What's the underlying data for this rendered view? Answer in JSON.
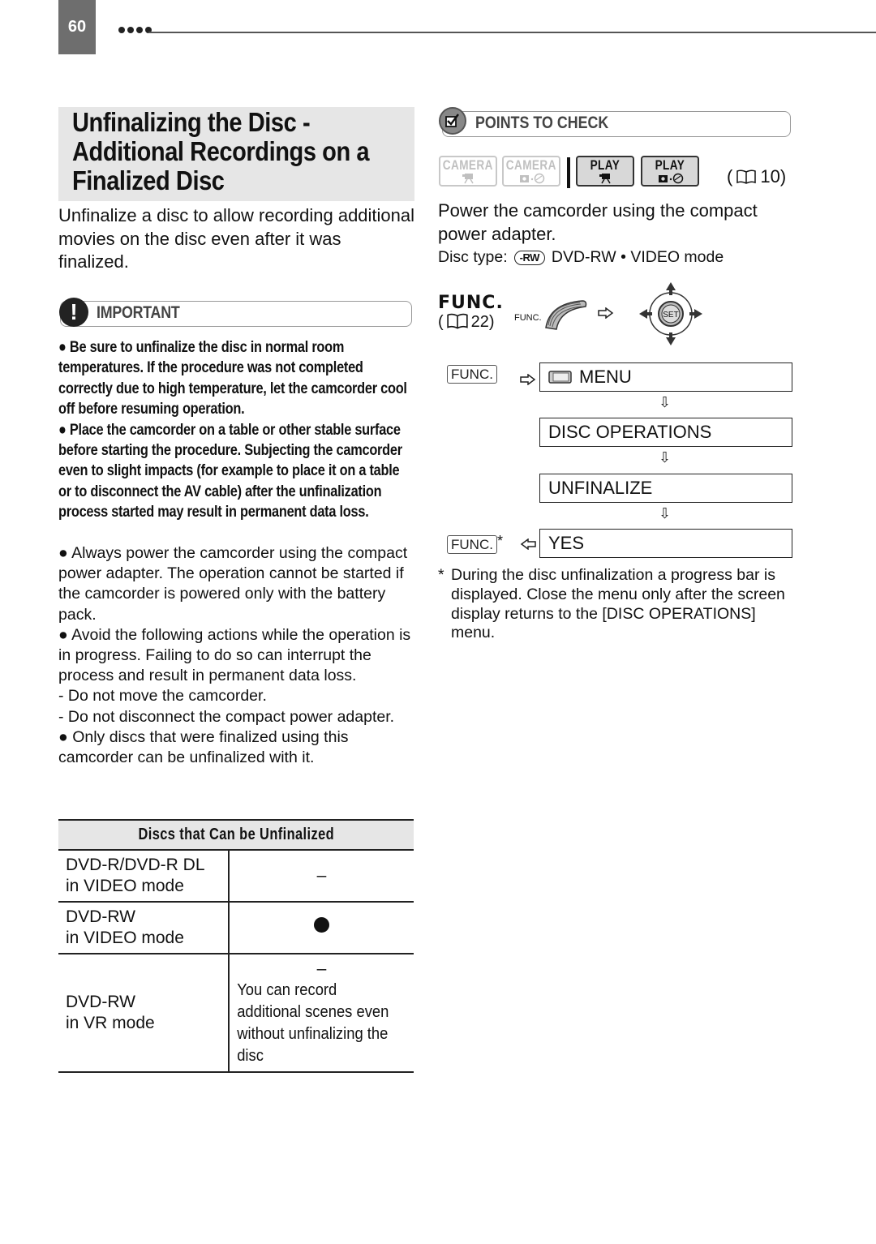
{
  "header": {
    "page_number": "60"
  },
  "title": {
    "lines": [
      "Unfinalizing the Disc -",
      "Additional Recordings on a",
      "Finalized Disc"
    ]
  },
  "intro": "Unfinalize a disc to allow recording additional movies on the disc even after it was finalized.",
  "important": {
    "label": "IMPORTANT",
    "bold_notes": [
      "● Be sure to unfinalize the disc in normal room temperatures. If the procedure was not completed correctly due to high temperature, let the camcorder cool off before resuming operation.",
      "● Place the camcorder on a table or other stable surface before starting the procedure. Subjecting the camcorder even to slight impacts (for example to place it on a table or to disconnect the AV cable) after the unfinalization process started may result in permanent data loss."
    ],
    "notes": [
      "● Always power the camcorder using the compact power adapter. The operation cannot be started if the camcorder is powered only with the battery pack.",
      "● Avoid the following actions while the operation is in progress. Failing to do so can interrupt the process and result in permanent data loss.",
      "-  Do not move the camcorder.",
      "-  Do not disconnect the compact power adapter.",
      "● Only discs that were finalized using this camcorder can be unfinalized with it."
    ]
  },
  "table": {
    "header": "Discs that Can be Unfinalized",
    "rows": [
      {
        "disc_line1": "DVD-R/DVD-R DL",
        "disc_line2": "in VIDEO mode",
        "value": "–",
        "note": ""
      },
      {
        "disc_line1": "DVD-RW",
        "disc_line2": "in VIDEO mode",
        "value": "●",
        "note": ""
      },
      {
        "disc_line1": "DVD-RW",
        "disc_line2": "in VR mode",
        "value": "–",
        "note_lines": [
          "You can record",
          "additional scenes even",
          "without unfinalizing the",
          "disc"
        ]
      }
    ]
  },
  "points_to_check": {
    "label": "POINTS TO CHECK",
    "modes": [
      {
        "label": "CAMERA",
        "icon": "movie-camera-icon",
        "active": false
      },
      {
        "label": "CAMERA",
        "icon": "photo-disc-icon",
        "active": false
      },
      {
        "label": "PLAY",
        "icon": "movie-camera-icon",
        "active": true
      },
      {
        "label": "PLAY",
        "icon": "photo-disc-icon",
        "active": true
      }
    ],
    "page_ref": "10",
    "power_text": "Power the camcorder using the compact power adapter.",
    "disc_type_label": "Disc type:",
    "disc_badge": "-RW",
    "disc_type_value": "DVD-RW • VIDEO mode"
  },
  "func": {
    "heading": "FUNC.",
    "page_ref": "22",
    "small_label": "FUNC.",
    "joystick_label": "SET"
  },
  "steps": {
    "func_button": "FUNC.",
    "items": [
      "MENU",
      "DISC OPERATIONS",
      "UNFINALIZE",
      "YES"
    ],
    "final_marker": "*"
  },
  "footnote": {
    "star": "*",
    "text": "During the disc unfinalization a progress bar is displayed. Close the menu only after the screen display returns to the [DISC OPERATIONS] menu."
  }
}
